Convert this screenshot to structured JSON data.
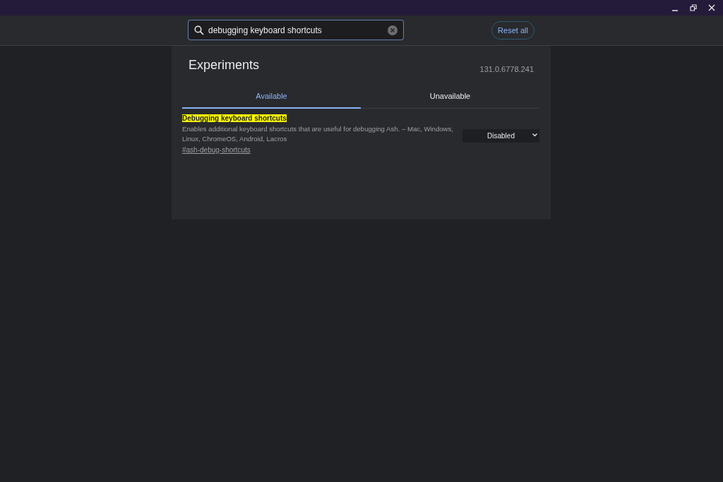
{
  "search": {
    "value": "debugging keyboard shortcuts"
  },
  "reset_button": "Reset all",
  "title": "Experiments",
  "version": "131.0.6778.241",
  "tabs": [
    {
      "label": "Available",
      "selected": true
    },
    {
      "label": "Unavailable",
      "selected": false
    }
  ],
  "experiments": [
    {
      "name": "Debugging keyboard shortcuts",
      "highlighted": true,
      "description": "Enables additional keyboard shortcuts that are useful for debugging Ash. – Mac, Windows, Linux, ChromeOS, Android, Lacros",
      "link": "#ash-debug-shortcuts",
      "value": "Disabled"
    }
  ]
}
